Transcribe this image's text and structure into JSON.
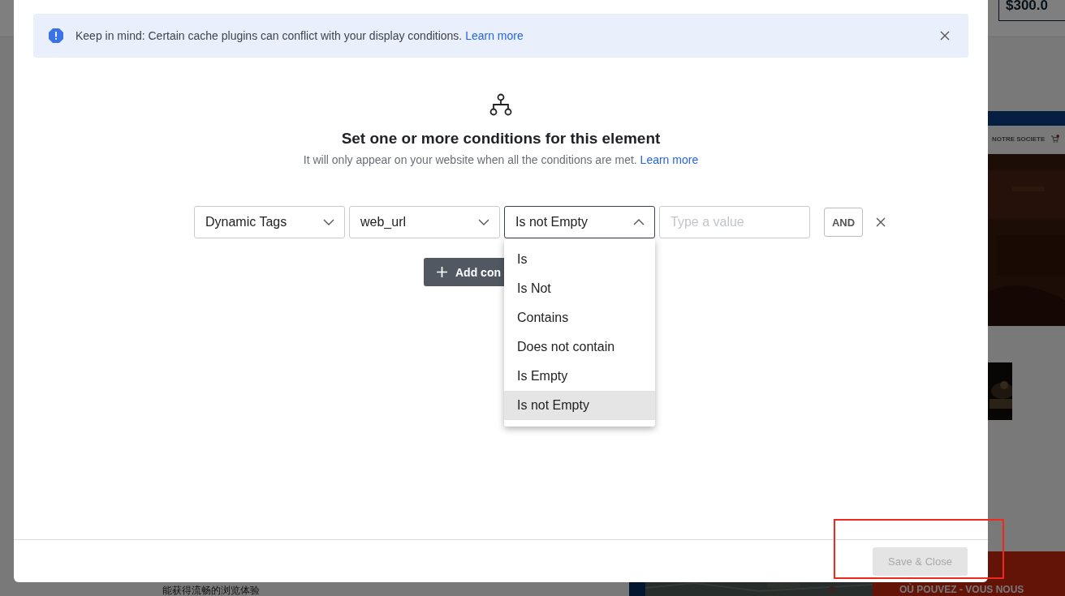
{
  "background_page": {
    "price": "$300.0",
    "nav_item": "NOTRE SOCIETE",
    "banner_text": "OÙ POUVEZ - VOUS NOUS",
    "paragraph_line": "能获得流畅的浏览体验"
  },
  "notice": {
    "text": "Keep in mind: Certain cache plugins can conflict with your display conditions.",
    "link": "Learn more"
  },
  "heading": {
    "title": "Set one or more conditions for this element",
    "subtitle": "It will only appear on your website when all the conditions are met.",
    "link": "Learn more"
  },
  "condition": {
    "fields": [
      {
        "kind": "select",
        "value": "Dynamic Tags",
        "open": false
      },
      {
        "kind": "select",
        "value": "web_url",
        "open": false
      },
      {
        "kind": "select",
        "value": "Is not Empty",
        "open": true
      },
      {
        "kind": "input",
        "placeholder": "Type a value"
      }
    ],
    "operator": "AND"
  },
  "add_button": "Add con",
  "dropdown": {
    "options": [
      {
        "label": "Is",
        "selected": false
      },
      {
        "label": "Is Not",
        "selected": false
      },
      {
        "label": "Contains",
        "selected": false
      },
      {
        "label": "Does not contain",
        "selected": false
      },
      {
        "label": "Is Empty",
        "selected": false
      },
      {
        "label": "Is not Empty",
        "selected": true
      }
    ]
  },
  "footer": {
    "save_button": {
      "label": "Save & Close",
      "disabled": true
    },
    "highlighted": true
  }
}
